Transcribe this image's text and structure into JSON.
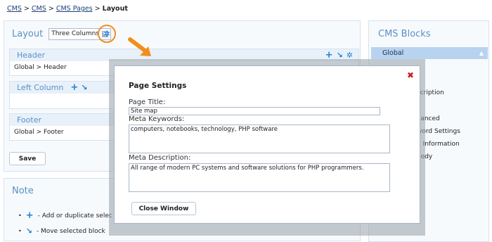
{
  "breadcrumb": {
    "items": [
      "CMS",
      "CMS",
      "CMS Pages"
    ],
    "current": "Layout",
    "separator": ">"
  },
  "layout": {
    "title": "Layout",
    "select_value": "Three Columns",
    "sections": [
      {
        "name": "Header",
        "content": "Global > Header"
      },
      {
        "name": "Left Column",
        "content": ""
      },
      {
        "name": "Footer",
        "content": "Global > Footer"
      }
    ],
    "save_label": "Save"
  },
  "note": {
    "title": "Note",
    "lines": [
      "- Add or duplicate selec",
      "- Move selected block"
    ]
  },
  "blocks": {
    "title": "CMS Blocks",
    "selected": "Global",
    "items": [
      "scription",
      "vanced",
      "word Settings",
      "d Information",
      "body"
    ]
  },
  "dialog": {
    "title": "Page Settings",
    "page_title_label": "Page Title:",
    "page_title_value": "Site map",
    "meta_keywords_label": "Meta Keywords:",
    "meta_keywords_value": "computers, notebooks, technology, PHP software",
    "meta_description_label": "Meta Description:",
    "meta_description_value": "All range of modern PC systems and software solutions for PHP programmers.",
    "close_label": "Close Window",
    "close_icon": "✖"
  },
  "colors": {
    "accent": "#5a8fc6",
    "highlight": "#f28e1c",
    "icon_blue": "#1f7ed1",
    "close_red": "#cc1f1f"
  }
}
